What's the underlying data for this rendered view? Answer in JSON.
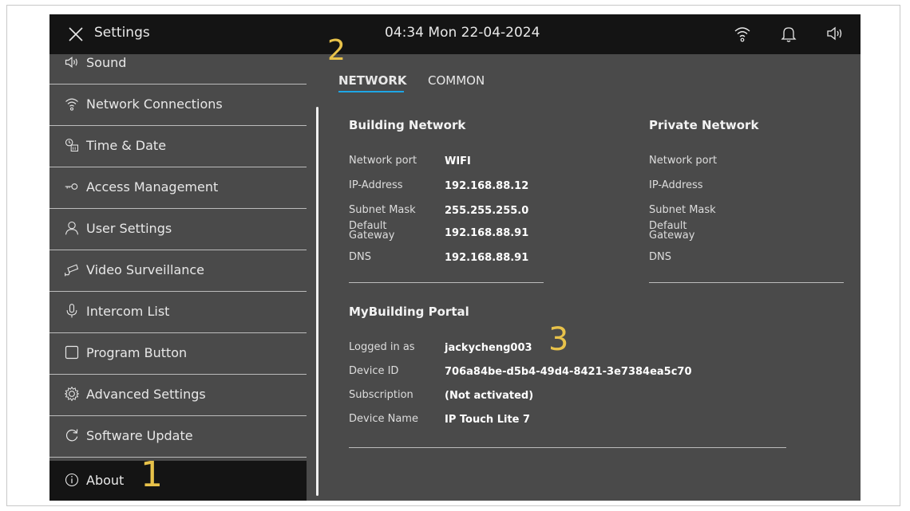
{
  "header": {
    "title": "Settings",
    "clock": "04:34  Mon 22-04-2024",
    "icons": [
      "close-icon",
      "wifi-icon",
      "bell-icon",
      "speaker-icon"
    ]
  },
  "sidebar": {
    "items": [
      {
        "label": "Sound",
        "icon": "speaker-icon"
      },
      {
        "label": "Network Connections",
        "icon": "wifi-icon"
      },
      {
        "label": "Time & Date",
        "icon": "clock-calendar-icon"
      },
      {
        "label": "Access Management",
        "icon": "key-icon"
      },
      {
        "label": "User Settings",
        "icon": "user-icon"
      },
      {
        "label": "Video Surveillance",
        "icon": "camera-icon"
      },
      {
        "label": "Intercom List",
        "icon": "microphone-icon"
      },
      {
        "label": "Program Button",
        "icon": "square-icon"
      },
      {
        "label": "Advanced Settings",
        "icon": "gear-icon"
      },
      {
        "label": "Software Update",
        "icon": "refresh-icon"
      },
      {
        "label": "About",
        "icon": "info-icon",
        "active": true
      }
    ]
  },
  "tabs": [
    {
      "label": "NETWORK",
      "active": true
    },
    {
      "label": "COMMON",
      "active": false
    }
  ],
  "building_network": {
    "title": "Building Network",
    "rows": [
      {
        "label": "Network port",
        "value": "WIFI"
      },
      {
        "label": "IP-Address",
        "value": "192.168.88.12"
      },
      {
        "label": "Subnet Mask",
        "value": "255.255.255.0"
      },
      {
        "label": "Default\nGateway",
        "value": "192.168.88.91"
      },
      {
        "label": "DNS",
        "value": "192.168.88.91"
      }
    ]
  },
  "private_network": {
    "title": "Private Network",
    "rows": [
      {
        "label": "Network port"
      },
      {
        "label": "IP-Address"
      },
      {
        "label": "Subnet Mask"
      },
      {
        "label": "Default\nGateway"
      },
      {
        "label": "DNS"
      }
    ]
  },
  "portal": {
    "title": "MyBuilding Portal",
    "rows": [
      {
        "label": "Logged in as",
        "value": "jackycheng003"
      },
      {
        "label": "Device ID",
        "value": "706a84be-d5b4-49d4-8421-3e7384ea5c70"
      },
      {
        "label": "Subscription",
        "value": "(Not activated)"
      },
      {
        "label": "Device Name",
        "value": "IP Touch Lite 7"
      }
    ]
  },
  "callouts": [
    "1",
    "2",
    "3"
  ],
  "colors": {
    "accent": "#1ea6e5",
    "callout": "#e8c24a",
    "topbar": "#141414",
    "panel": "#4a4a4a"
  }
}
